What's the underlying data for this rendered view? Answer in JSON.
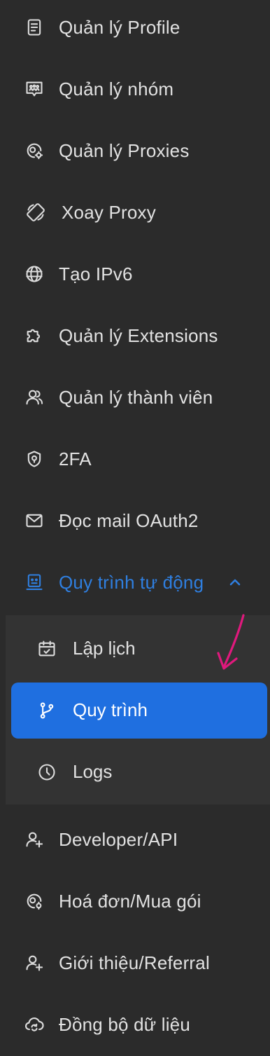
{
  "sidebar": {
    "items": [
      {
        "label": "Quản lý Profile",
        "icon": "document-icon"
      },
      {
        "label": "Quản lý nhóm",
        "icon": "group-icon"
      },
      {
        "label": "Quản lý Proxies",
        "icon": "proxy-icon"
      },
      {
        "label": "Xoay Proxy",
        "icon": "rotate-icon"
      },
      {
        "label": "Tạo IPv6",
        "icon": "globe-icon"
      },
      {
        "label": "Quản lý Extensions",
        "icon": "puzzle-icon"
      },
      {
        "label": "Quản lý thành viên",
        "icon": "users-icon"
      },
      {
        "label": "2FA",
        "icon": "shield-icon"
      },
      {
        "label": "Đọc mail OAuth2",
        "icon": "mail-icon"
      },
      {
        "label": "Quy trình tự động",
        "icon": "robot-icon",
        "expanded": true
      },
      {
        "label": "Developer/API",
        "icon": "user-plus-icon"
      },
      {
        "label": "Hoá đơn/Mua gói",
        "icon": "invoice-icon"
      },
      {
        "label": "Giới thiệu/Referral",
        "icon": "referral-icon"
      },
      {
        "label": "Đồng bộ dữ liệu",
        "icon": "cloud-sync-icon"
      }
    ],
    "submenu": [
      {
        "label": "Lập lịch",
        "icon": "calendar-icon"
      },
      {
        "label": "Quy trình",
        "icon": "git-branch-icon",
        "active": true
      },
      {
        "label": "Logs",
        "icon": "clock-icon"
      }
    ]
  },
  "colors": {
    "background": "#2b2b2b",
    "submenu_background": "#333333",
    "accent": "#2f7fe0",
    "active_bg": "#1f6fe0",
    "annotation_arrow": "#e0197d"
  }
}
